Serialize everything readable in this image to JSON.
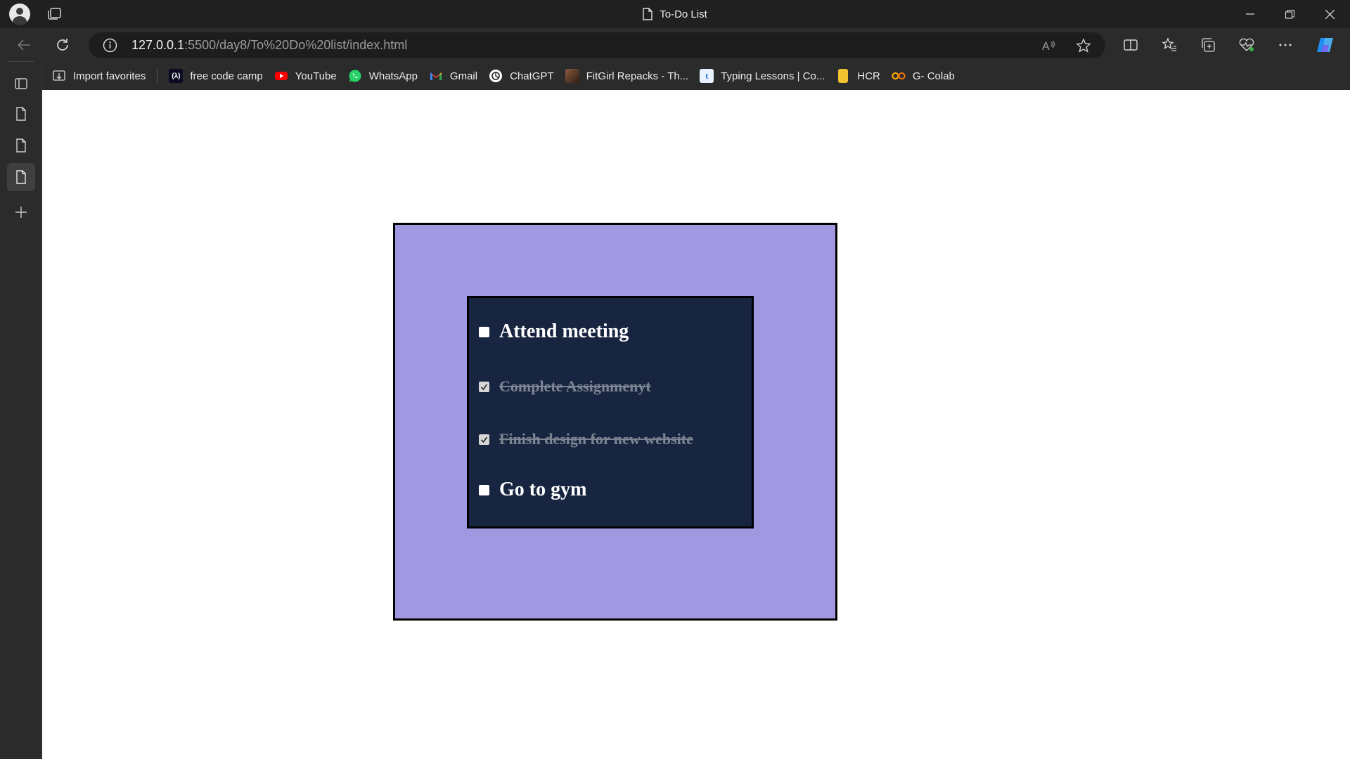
{
  "window": {
    "title": "To-Do List"
  },
  "address_bar": {
    "host": "127.0.0.1",
    "path": ":5500/day8/To%20Do%20list/index.html"
  },
  "favorites": [
    {
      "label": "Import favorites",
      "icon": "import-icon"
    },
    {
      "label": "free code camp",
      "icon": "freecodecamp-icon"
    },
    {
      "label": "YouTube",
      "icon": "youtube-icon"
    },
    {
      "label": "WhatsApp",
      "icon": "whatsapp-icon"
    },
    {
      "label": "Gmail",
      "icon": "gmail-icon"
    },
    {
      "label": "ChatGPT",
      "icon": "chatgpt-icon"
    },
    {
      "label": "FitGirl Repacks - Th...",
      "icon": "fitgirl-icon"
    },
    {
      "label": "Typing Lessons | Co...",
      "icon": "typing-icon"
    },
    {
      "label": "HCR",
      "icon": "hcr-icon"
    },
    {
      "label": "G- Colab",
      "icon": "colab-icon"
    }
  ],
  "todo": {
    "items": [
      {
        "text": "Attend meeting",
        "done": false
      },
      {
        "text": "Complete Assignmenyt",
        "done": true
      },
      {
        "text": "Finish design for new website",
        "done": true
      },
      {
        "text": "Go to gym",
        "done": false
      }
    ]
  },
  "colors": {
    "outer_box": "#a098e0",
    "todo_box": "#172540",
    "browser_chrome": "#2b2b2b",
    "titlebar": "#202020"
  }
}
